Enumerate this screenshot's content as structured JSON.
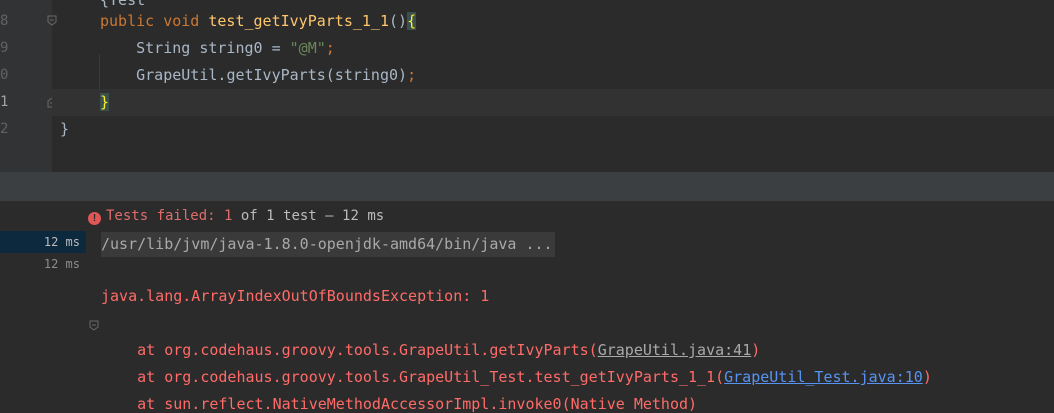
{
  "editor": {
    "lines": [
      {
        "number": "",
        "parts": [
          {
            "text": "{Test",
            "cls": ""
          }
        ]
      },
      {
        "number": "8",
        "parts": [
          {
            "text": "public void ",
            "cls": "kw"
          },
          {
            "text": "test_getIvyParts_1_1",
            "cls": ""
          },
          {
            "text": "()",
            "cls": ""
          },
          {
            "text": "{",
            "cls": "brace-hl"
          }
        ]
      },
      {
        "number": "9",
        "parts": [
          {
            "text": "    String string0 = ",
            "cls": ""
          },
          {
            "text": "\"@M\"",
            "cls": "str"
          },
          {
            "text": ";",
            "cls": "kw"
          }
        ]
      },
      {
        "number": "0",
        "parts": [
          {
            "text": "    GrapeUtil.",
            "cls": ""
          },
          {
            "text": "getIvyParts",
            "cls": ""
          },
          {
            "text": "(string0)",
            "cls": ""
          },
          {
            "text": ";",
            "cls": "kw"
          }
        ]
      },
      {
        "number": "1",
        "parts": [
          {
            "text": "}",
            "cls": "brace-hl"
          }
        ]
      },
      {
        "number": "2",
        "parts": [
          {
            "text": "}",
            "cls": ""
          }
        ]
      }
    ]
  },
  "run": {
    "status_prefix": "Tests failed: ",
    "status_count": "1",
    "status_suffix": " of 1 test – 12 ms",
    "tree": [
      {
        "time": "12 ms"
      },
      {
        "time": "12 ms"
      }
    ],
    "command": "/usr/lib/jvm/java-1.8.0-openjdk-amd64/bin/java ...",
    "exception": "java.lang.ArrayIndexOutOfBoundsException: 1",
    "trace": [
      {
        "prefix": "    at org.codehaus.groovy.tools.GrapeUtil.getIvyParts(",
        "link": "GrapeUtil.java:41",
        "suffix": ")",
        "link_style": "gray"
      },
      {
        "prefix": "    at org.codehaus.groovy.tools.GrapeUtil_Test.test_getIvyParts_1_1(",
        "link": "GrapeUtil_Test.java:10",
        "suffix": ")",
        "link_style": "blue"
      },
      {
        "prefix": "    at sun.reflect.NativeMethodAccessorImpl.invoke0(Native Method)",
        "link": "",
        "suffix": "",
        "link_style": ""
      }
    ]
  },
  "colors": {
    "editor_bg": "#2b2b2b",
    "gutter_bg": "#313335",
    "keyword": "#cc7832",
    "string": "#6a8759",
    "error": "#ff6b68",
    "link_blue": "#5794f2"
  }
}
